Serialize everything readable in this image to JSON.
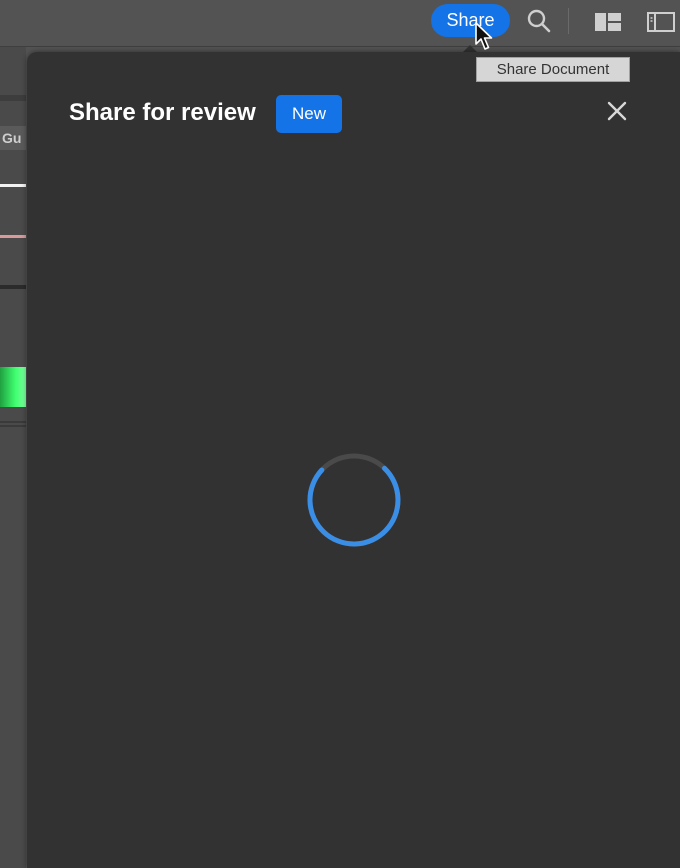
{
  "topbar": {
    "share_label": "Share",
    "icons": [
      "search-icon",
      "arrange-documents-icon",
      "panel-toggle-icon",
      "cursor-arrow-icon"
    ]
  },
  "tooltip": {
    "text": "Share Document"
  },
  "left_panel": {
    "tab_label": "Gu"
  },
  "dialog": {
    "title": "Share for review",
    "badge": "New",
    "close_icon": "close-icon",
    "loading_icon": "spinner-icon"
  },
  "colors": {
    "accent_blue": "#1473e6",
    "dialog_background": "#323232",
    "app_background": "#535353",
    "spinner_track": "#4a4a4a",
    "spinner_arc": "#3a8ee6"
  }
}
